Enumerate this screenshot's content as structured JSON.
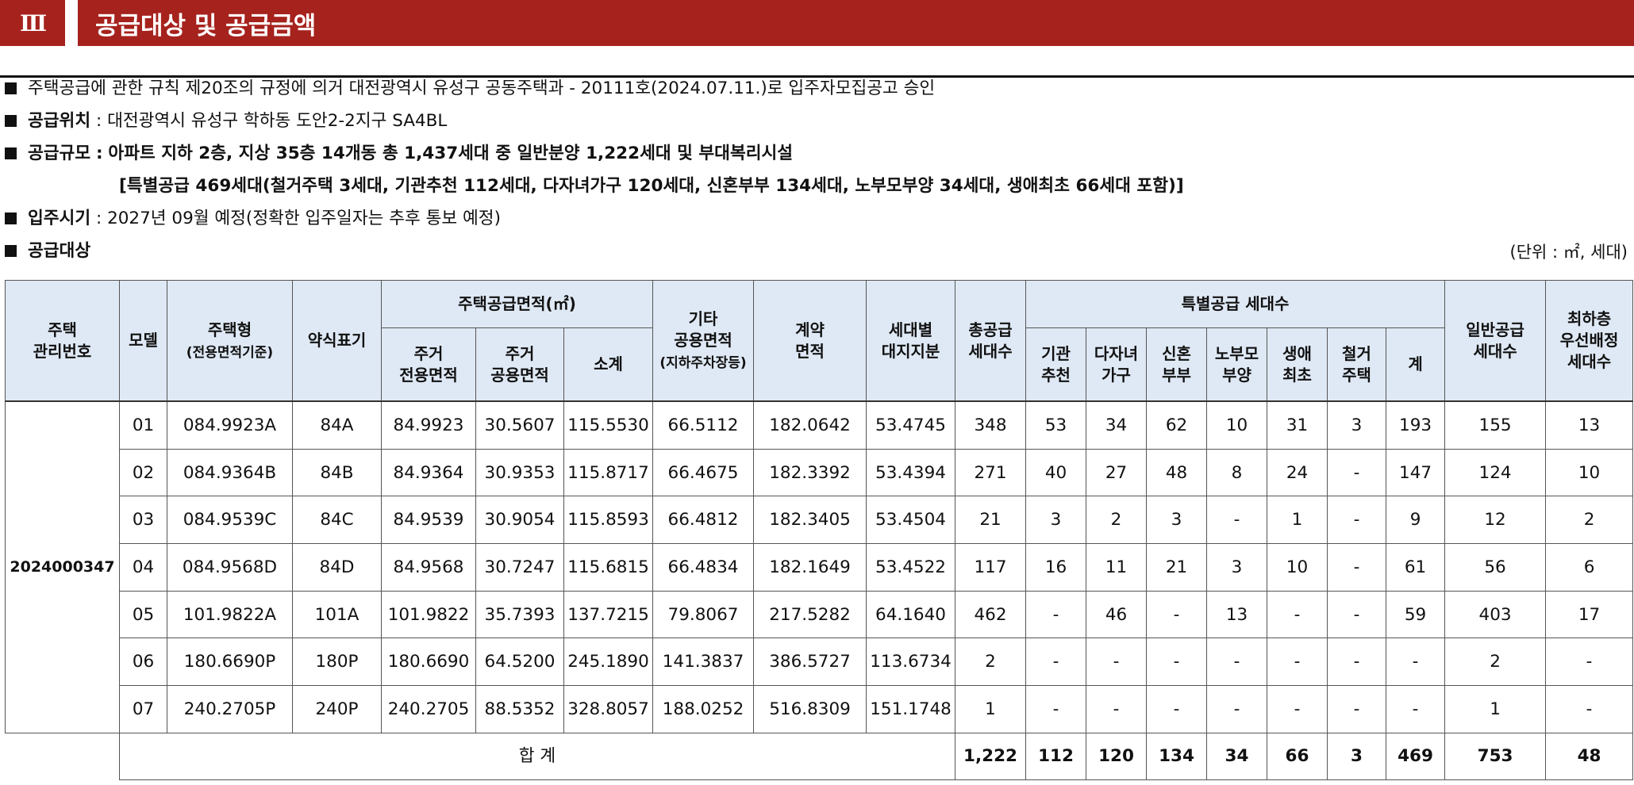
{
  "header": {
    "section_num": "Ⅲ",
    "title": "공급대상 및 공급금액"
  },
  "info": {
    "approval": "주택공급에 관한 규칙 제20조의 규정에 의거 대전광역시 유성구 공동주택과 - 20111호(2024.07.11.)로 입주자모집공고 승인",
    "location_label": "공급위치",
    "location_value": "대전광역시 유성구 학하동 도안2-2지구 SA4BL",
    "scale_label": "공급규모",
    "scale_value": "아파트 지하 2층, 지상 35층 14개동 총 1,437세대 중 일반분양 1,222세대 및 부대복리시설",
    "scale_special": "[특별공급 469세대(철거주택 3세대, 기관추천 112세대, 다자녀가구 120세대, 신혼부부 134세대, 노부모부양 34세대, 생애최초 66세대 포함)]",
    "move_in_label": "입주시기",
    "move_in_value": "2027년 09월 예정(정확한 입주일자는 추후 통보 예정)",
    "target_label": "공급대상",
    "unit": "(단위 : ㎡, 세대)",
    "colon": ":"
  },
  "table": {
    "headers": {
      "mgmt_no_1": "주택",
      "mgmt_no_2": "관리번호",
      "model": "모델",
      "type_1": "주택형",
      "type_2": "(전용면적기준)",
      "abbr": "약식표기",
      "supply_area": "주택공급면적(㎡)",
      "exclusive_1": "주거",
      "exclusive_2": "전용면적",
      "common_1": "주거",
      "common_2": "공용면적",
      "subtotal": "소계",
      "other_1": "기타",
      "other_2": "공용면적",
      "other_3": "(지하주차장등)",
      "contract_1": "계약",
      "contract_2": "면적",
      "land_1": "세대별",
      "land_2": "대지지분",
      "total_1": "총공급",
      "total_2": "세대수",
      "special": "특별공급 세대수",
      "sp_inst_1": "기관",
      "sp_inst_2": "추천",
      "sp_multi_1": "다자녀",
      "sp_multi_2": "가구",
      "sp_newly_1": "신혼",
      "sp_newly_2": "부부",
      "sp_elder_1": "노부모",
      "sp_elder_2": "부양",
      "sp_first_1": "생애",
      "sp_first_2": "최초",
      "sp_demol_1": "철거",
      "sp_demol_2": "주택",
      "sp_sum": "계",
      "general_1": "일반공급",
      "general_2": "세대수",
      "lowest_1": "최하층",
      "lowest_2": "우선배정",
      "lowest_3": "세대수"
    },
    "mgmt_no": "2024000347",
    "rows": [
      {
        "model": "01",
        "type": "084.9923A",
        "abbr": "84A",
        "exclusive": "84.9923",
        "common": "30.5607",
        "subtotal": "115.5530",
        "other": "66.5112",
        "contract": "182.0642",
        "land": "53.4745",
        "total": "348",
        "inst": "53",
        "multi": "34",
        "newly": "62",
        "elder": "10",
        "first": "31",
        "demol": "3",
        "sum": "193",
        "general": "155",
        "lowest": "13"
      },
      {
        "model": "02",
        "type": "084.9364B",
        "abbr": "84B",
        "exclusive": "84.9364",
        "common": "30.9353",
        "subtotal": "115.8717",
        "other": "66.4675",
        "contract": "182.3392",
        "land": "53.4394",
        "total": "271",
        "inst": "40",
        "multi": "27",
        "newly": "48",
        "elder": "8",
        "first": "24",
        "demol": "-",
        "sum": "147",
        "general": "124",
        "lowest": "10"
      },
      {
        "model": "03",
        "type": "084.9539C",
        "abbr": "84C",
        "exclusive": "84.9539",
        "common": "30.9054",
        "subtotal": "115.8593",
        "other": "66.4812",
        "contract": "182.3405",
        "land": "53.4504",
        "total": "21",
        "inst": "3",
        "multi": "2",
        "newly": "3",
        "elder": "-",
        "first": "1",
        "demol": "-",
        "sum": "9",
        "general": "12",
        "lowest": "2"
      },
      {
        "model": "04",
        "type": "084.9568D",
        "abbr": "84D",
        "exclusive": "84.9568",
        "common": "30.7247",
        "subtotal": "115.6815",
        "other": "66.4834",
        "contract": "182.1649",
        "land": "53.4522",
        "total": "117",
        "inst": "16",
        "multi": "11",
        "newly": "21",
        "elder": "3",
        "first": "10",
        "demol": "-",
        "sum": "61",
        "general": "56",
        "lowest": "6"
      },
      {
        "model": "05",
        "type": "101.9822A",
        "abbr": "101A",
        "exclusive": "101.9822",
        "common": "35.7393",
        "subtotal": "137.7215",
        "other": "79.8067",
        "contract": "217.5282",
        "land": "64.1640",
        "total": "462",
        "inst": "-",
        "multi": "46",
        "newly": "-",
        "elder": "13",
        "first": "-",
        "demol": "-",
        "sum": "59",
        "general": "403",
        "lowest": "17"
      },
      {
        "model": "06",
        "type": "180.6690P",
        "abbr": "180P",
        "exclusive": "180.6690",
        "common": "64.5200",
        "subtotal": "245.1890",
        "other": "141.3837",
        "contract": "386.5727",
        "land": "113.6734",
        "total": "2",
        "inst": "-",
        "multi": "-",
        "newly": "-",
        "elder": "-",
        "first": "-",
        "demol": "-",
        "sum": "-",
        "general": "2",
        "lowest": "-"
      },
      {
        "model": "07",
        "type": "240.2705P",
        "abbr": "240P",
        "exclusive": "240.2705",
        "common": "88.5352",
        "subtotal": "328.8057",
        "other": "188.0252",
        "contract": "516.8309",
        "land": "151.1748",
        "total": "1",
        "inst": "-",
        "multi": "-",
        "newly": "-",
        "elder": "-",
        "first": "-",
        "demol": "-",
        "sum": "-",
        "general": "1",
        "lowest": "-"
      }
    ],
    "total_row": {
      "label": "합 계",
      "total": "1,222",
      "inst": "112",
      "multi": "120",
      "newly": "134",
      "elder": "34",
      "first": "66",
      "demol": "3",
      "sum": "469",
      "general": "753",
      "lowest": "48"
    }
  }
}
